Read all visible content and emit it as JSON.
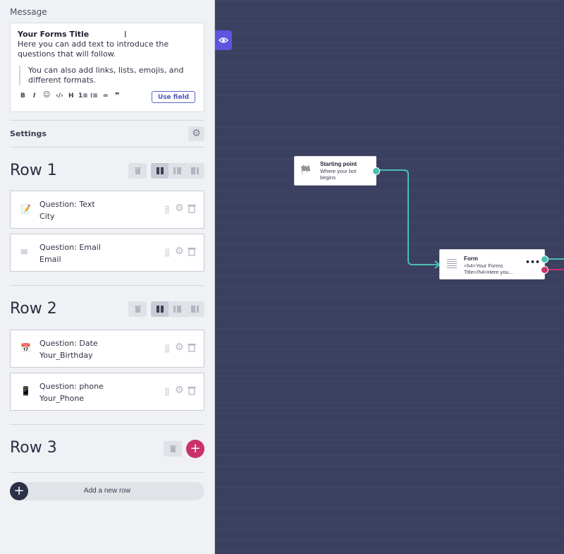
{
  "message": {
    "label": "Message",
    "title": "Your Forms Title",
    "body": "Here you can add text to introduce the questions that will follow.",
    "quote": "You can also add links, lists, emojis, and different formats.",
    "toolbar": {
      "bold": "B",
      "italic": "I",
      "heading": "H",
      "use_field": "Use field"
    }
  },
  "settings": {
    "label": "Settings"
  },
  "rows": [
    {
      "title": "Row 1",
      "questions": [
        {
          "title": "Question: Text",
          "variable": "City",
          "icon": "memo-icon"
        },
        {
          "title": "Question: Email",
          "variable": "Email",
          "icon": "envelope-icon"
        }
      ]
    },
    {
      "title": "Row 2",
      "questions": [
        {
          "title": "Question: Date",
          "variable": "Your_Birthday",
          "icon": "calendar-icon"
        },
        {
          "title": "Question: phone",
          "variable": "Your_Phone",
          "icon": "mobile-phone-icon"
        }
      ]
    },
    {
      "title": "Row 3",
      "questions": []
    }
  ],
  "add_row": {
    "label": "Add a new row"
  },
  "canvas": {
    "start_node": {
      "title": "Starting point",
      "subtitle": "Where your bot begins",
      "icon": "checkered-flag-icon"
    },
    "form_node": {
      "title": "Form",
      "subtitle": "<h4>Your Forms Title</h4>Here you...",
      "icon": "form-lines-icon"
    }
  },
  "colors": {
    "accent": "#5b55e0",
    "pink": "#c9336a",
    "connector": "#4bbfb0",
    "canvas": "#3b4060"
  }
}
